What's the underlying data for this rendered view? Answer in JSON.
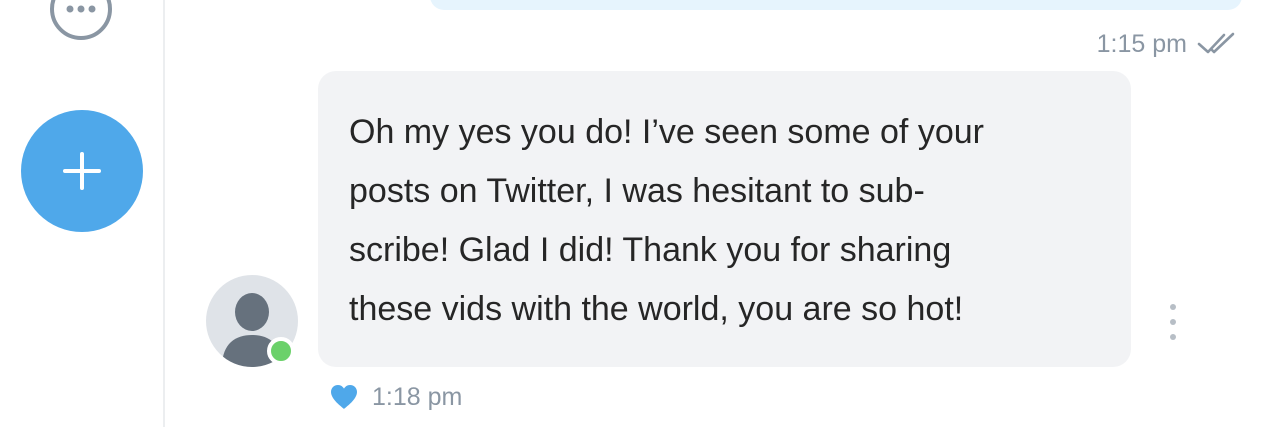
{
  "sidebar": {
    "more_icon": "more-horizontal-icon",
    "add_icon": "plus-icon",
    "accent_color": "#4fa8ea"
  },
  "sent_message": {
    "time": "1:15 pm",
    "status_icon": "double-check-icon"
  },
  "received_message": {
    "text": "Oh my yes you do! I’ve seen some of your\nposts on Twitter, I was hesitant to sub-\nscribe! Glad I did! Thank you for sharing\nthese vids with the world, you are so hot!",
    "time": "1:18 pm",
    "liked": true,
    "like_icon": "heart-icon",
    "options_icon": "vertical-ellipsis-icon"
  },
  "sender": {
    "avatar_icon": "default-avatar-icon",
    "online": true,
    "online_color": "#6bd16a"
  }
}
